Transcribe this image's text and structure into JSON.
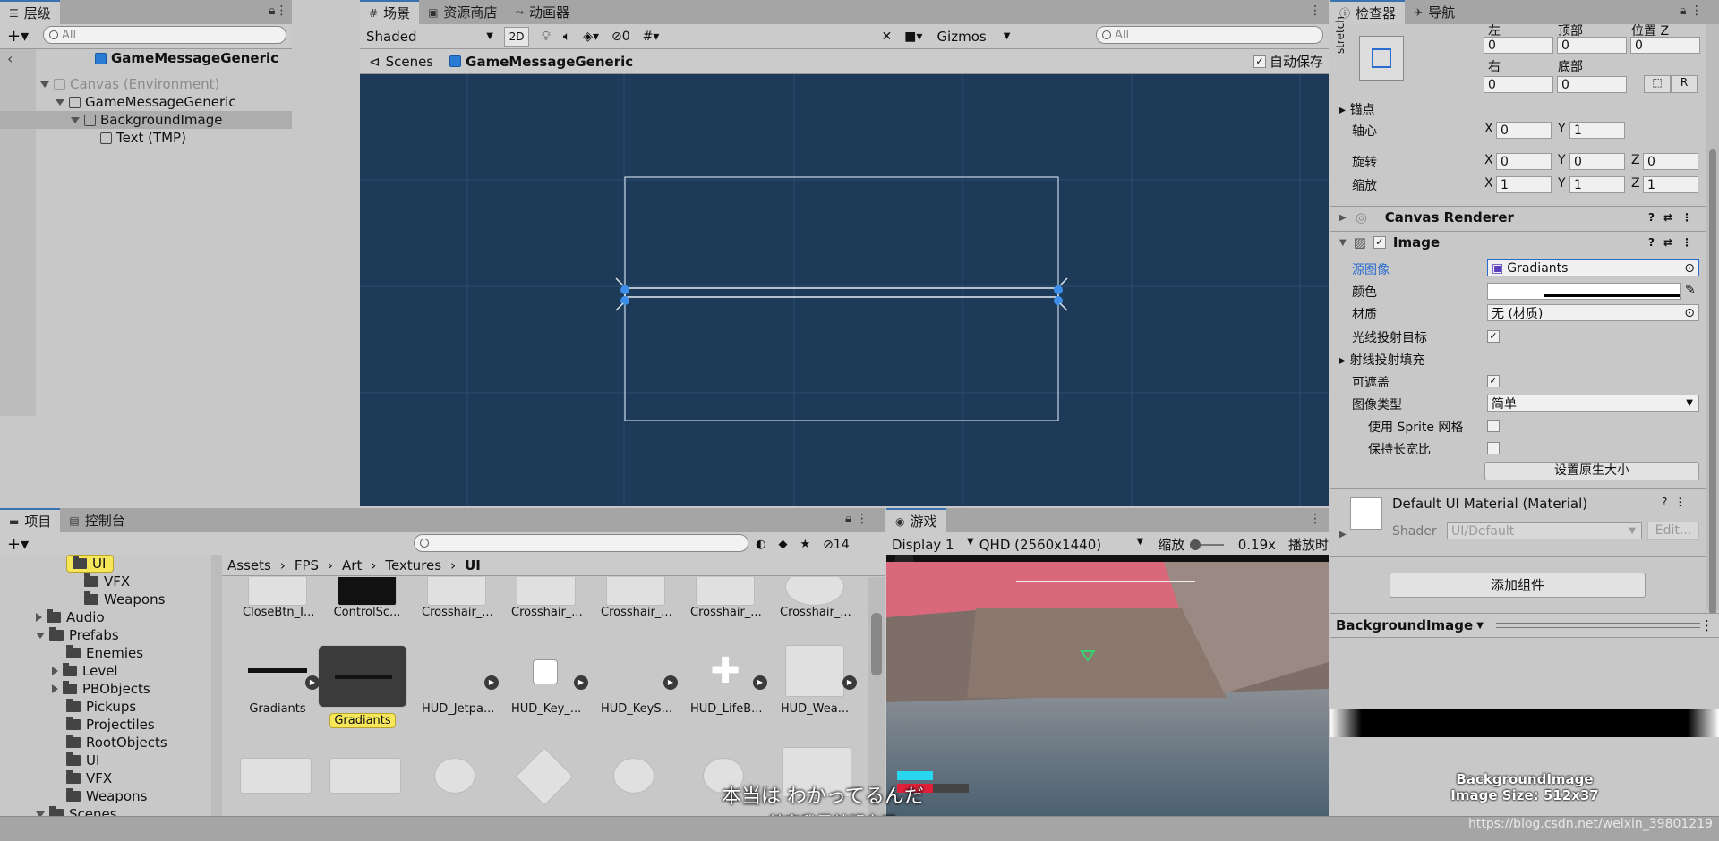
{
  "hierarchy": {
    "tab": "层级",
    "search_placeholder": "All",
    "scene_name": "GameMessageGeneric",
    "items": [
      {
        "label": "Canvas (Environment)"
      },
      {
        "label": "GameMessageGeneric"
      },
      {
        "label": "BackgroundImage"
      },
      {
        "label": "Text (TMP)"
      }
    ]
  },
  "scene": {
    "tabs": [
      "场景",
      "资源商店",
      "动画器"
    ],
    "shading": "Shaded",
    "mode_2d": "2D",
    "hidden_count": "0",
    "gizmos": "Gizmos",
    "search_placeholder": "All",
    "breadcrumb_root": "Scenes",
    "breadcrumb_item": "GameMessageGeneric",
    "autosave_label": "自动保存",
    "autosave": true
  },
  "project": {
    "tabs": [
      "项目",
      "控制台"
    ],
    "hidden_count": "14",
    "tree": [
      {
        "label": "UI",
        "selected": true
      },
      {
        "label": "VFX"
      },
      {
        "label": "Weapons"
      },
      {
        "label": "Audio"
      },
      {
        "label": "Prefabs"
      },
      {
        "label": "Enemies"
      },
      {
        "label": "Level"
      },
      {
        "label": "PBObjects"
      },
      {
        "label": "Pickups"
      },
      {
        "label": "Projectiles"
      },
      {
        "label": "RootObjects"
      },
      {
        "label": "UI"
      },
      {
        "label": "VFX"
      },
      {
        "label": "Weapons"
      },
      {
        "label": "Scenes"
      }
    ],
    "path": [
      "Assets",
      "FPS",
      "Art",
      "Textures",
      "UI"
    ],
    "assets_row1": [
      "CloseBtn_I...",
      "ControlSc...",
      "Crosshair_...",
      "Crosshair_...",
      "Crosshair_...",
      "Crosshair_...",
      "Crosshair_..."
    ],
    "assets_row2": [
      "Gradiants",
      "Gradiants",
      "HUD_Jetpa...",
      "HUD_Key_...",
      "HUD_KeyS...",
      "HUD_LifeB...",
      "HUD_Wea..."
    ]
  },
  "game": {
    "tab": "游戏",
    "display": "Display 1",
    "resolution": "QHD (2560x1440)",
    "scale_label": "缩放",
    "scale_value": "0.19x",
    "play_label": "播放时",
    "subtitle_jp": "本当は わかってるんだ",
    "subtitle_cn": "其实我早就明白了"
  },
  "inspector": {
    "tabs": [
      "检查器",
      "导航"
    ],
    "stretch": "stretch",
    "rect": {
      "left_label": "左",
      "top_label": "顶部",
      "posz_label": "位置 Z",
      "left": "0",
      "top": "0",
      "posz": "0",
      "right_label": "右",
      "bottom_label": "底部",
      "right": "0",
      "bottom": "0",
      "r_button": "R"
    },
    "anchors_label": "锚点",
    "pivot_label": "轴心",
    "pivot_x": "0",
    "pivot_y": "1",
    "rotation_label": "旋转",
    "rot_x": "0",
    "rot_y": "0",
    "rot_z": "0",
    "scale_label": "缩放",
    "scale_x": "1",
    "scale_y": "1",
    "scale_z": "1",
    "canvas_renderer": "Canvas Renderer",
    "image": {
      "title": "Image",
      "source_label": "源图像",
      "source_value": "Gradiants",
      "color_label": "颜色",
      "material_label": "材质",
      "material_value": "无 (材质)",
      "raycast_target_label": "光线投射目标",
      "raycast_padding_label": "射线投射填充",
      "maskable_label": "可遮盖",
      "image_type_label": "图像类型",
      "image_type_value": "简单",
      "use_sprite_mesh_label": "使用 Sprite 网格",
      "preserve_aspect_label": "保持长宽比",
      "native_size_button": "设置原生大小"
    },
    "material": {
      "name": "Default UI Material (Material)",
      "shader_label": "Shader",
      "shader_value": "UI/Default",
      "edit_button": "Edit..."
    },
    "add_component": "添加组件",
    "preview_title": "BackgroundImage",
    "preview_caption_1": "BackgroundImage",
    "preview_caption_2": "Image Size: 512x37",
    "watermark": "https://blog.csdn.net/weixin_39801219"
  },
  "colors": {
    "scene_bg": "#1d3a58",
    "accent": "#3a72b0",
    "selected_folder": "#f6e75a"
  }
}
